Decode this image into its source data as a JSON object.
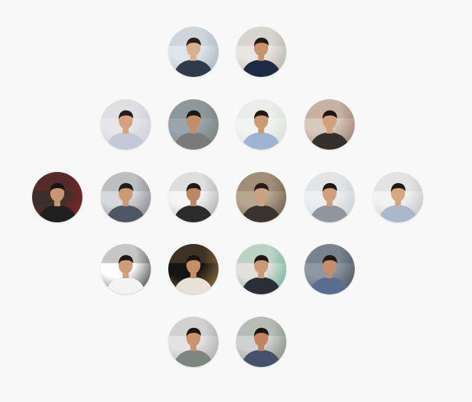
{
  "avatars": [
    {
      "id": "avatar-1",
      "scene": "indoor-office-two-people",
      "bg": "#dfe5ea",
      "bg2": "#9aa6b1",
      "skin": "#d9b08c",
      "shirt": "#2f3a4a",
      "hair": "#2a211c"
    },
    {
      "id": "avatar-2",
      "scene": "office-plant",
      "bg": "#e9e6e0",
      "bg2": "#a9a39a",
      "skin": "#c9926c",
      "shirt": "#1f2a44",
      "hair": "#231b16"
    },
    {
      "id": "avatar-3",
      "scene": "desk-laptop",
      "bg": "#e7e7ea",
      "bg2": "#c5c8cf",
      "skin": "#d4a37e",
      "shirt": "#c3c9d6",
      "hair": "#241c17"
    },
    {
      "id": "avatar-4",
      "scene": "street-car",
      "bg": "#9aa5ad",
      "bg2": "#6c756d",
      "skin": "#c28e6a",
      "shirt": "#7a7a7a",
      "hair": "#1e1814"
    },
    {
      "id": "avatar-5",
      "scene": "outdoor-bright",
      "bg": "#f2f4f2",
      "bg2": "#d3d9cf",
      "skin": "#cc9b74",
      "shirt": "#9fb4d3",
      "hair": "#201914"
    },
    {
      "id": "avatar-6",
      "scene": "cafe-selfie",
      "bg": "#d8c8bd",
      "bg2": "#8e6b57",
      "skin": "#d2a07c",
      "shirt": "#34302e",
      "hair": "#1d1611"
    },
    {
      "id": "avatar-7",
      "scene": "red-chair",
      "bg": "#3a2f2c",
      "bg2": "#a31d22",
      "skin": "#c99673",
      "shirt": "#202020",
      "hair": "#1a1412"
    },
    {
      "id": "avatar-8",
      "scene": "workspace",
      "bg": "#d7d8da",
      "bg2": "#6d6f75",
      "skin": "#c89a78",
      "shirt": "#4f5663",
      "hair": "#211a15"
    },
    {
      "id": "avatar-9",
      "scene": "bright-hall",
      "bg": "#f4f4f4",
      "bg2": "#9a9a9a",
      "skin": "#b88865",
      "shirt": "#2b2b2b",
      "hair": "#1e1814"
    },
    {
      "id": "avatar-10",
      "scene": "sepia-room",
      "bg": "#b8a58e",
      "bg2": "#5b4b3c",
      "skin": "#caa283",
      "shirt": "#3b342e",
      "hair": "#241b15"
    },
    {
      "id": "avatar-11",
      "scene": "light-wall",
      "bg": "#eceeef",
      "bg2": "#c2c7cc",
      "skin": "#cfa07c",
      "shirt": "#8f969e",
      "hair": "#1f1914"
    },
    {
      "id": "avatar-12",
      "scene": "event-hall",
      "bg": "#f2f2f2",
      "bg2": "#b7b7b7",
      "skin": "#d6a882",
      "shirt": "#a9b8cc",
      "hair": "#221a15"
    },
    {
      "id": "avatar-13",
      "scene": "checker-bg",
      "bg": "#ffffff",
      "bg2": "#1c1c1c",
      "skin": "#cf9e79",
      "shirt": "#f3f3f3",
      "hair": "#1f1813"
    },
    {
      "id": "avatar-14",
      "scene": "night-arch",
      "bg": "#141414",
      "bg2": "#b88a4e",
      "skin": "#c58f67",
      "shirt": "#e7e1d6",
      "hair": "#1c1612"
    },
    {
      "id": "avatar-15",
      "scene": "exhibit-booth",
      "bg": "#e2e0dd",
      "bg2": "#4ca786",
      "skin": "#c89a76",
      "shirt": "#2b2e38",
      "hair": "#1f1813"
    },
    {
      "id": "avatar-16",
      "scene": "conference",
      "bg": "#8d98a3",
      "bg2": "#3d434a",
      "skin": "#c28f6c",
      "shirt": "#5a6d8f",
      "hair": "#1f1813"
    },
    {
      "id": "avatar-17",
      "scene": "patterned-wall",
      "bg": "#e3e3e3",
      "bg2": "#9c9c9c",
      "skin": "#c8936f",
      "shirt": "#7d8580",
      "hair": "#1b1511"
    },
    {
      "id": "avatar-18",
      "scene": "office-glasses",
      "bg": "#cfd2cf",
      "bg2": "#6e7a73",
      "skin": "#c08462",
      "shirt": "#45526a",
      "hair": "#1c1612"
    }
  ]
}
